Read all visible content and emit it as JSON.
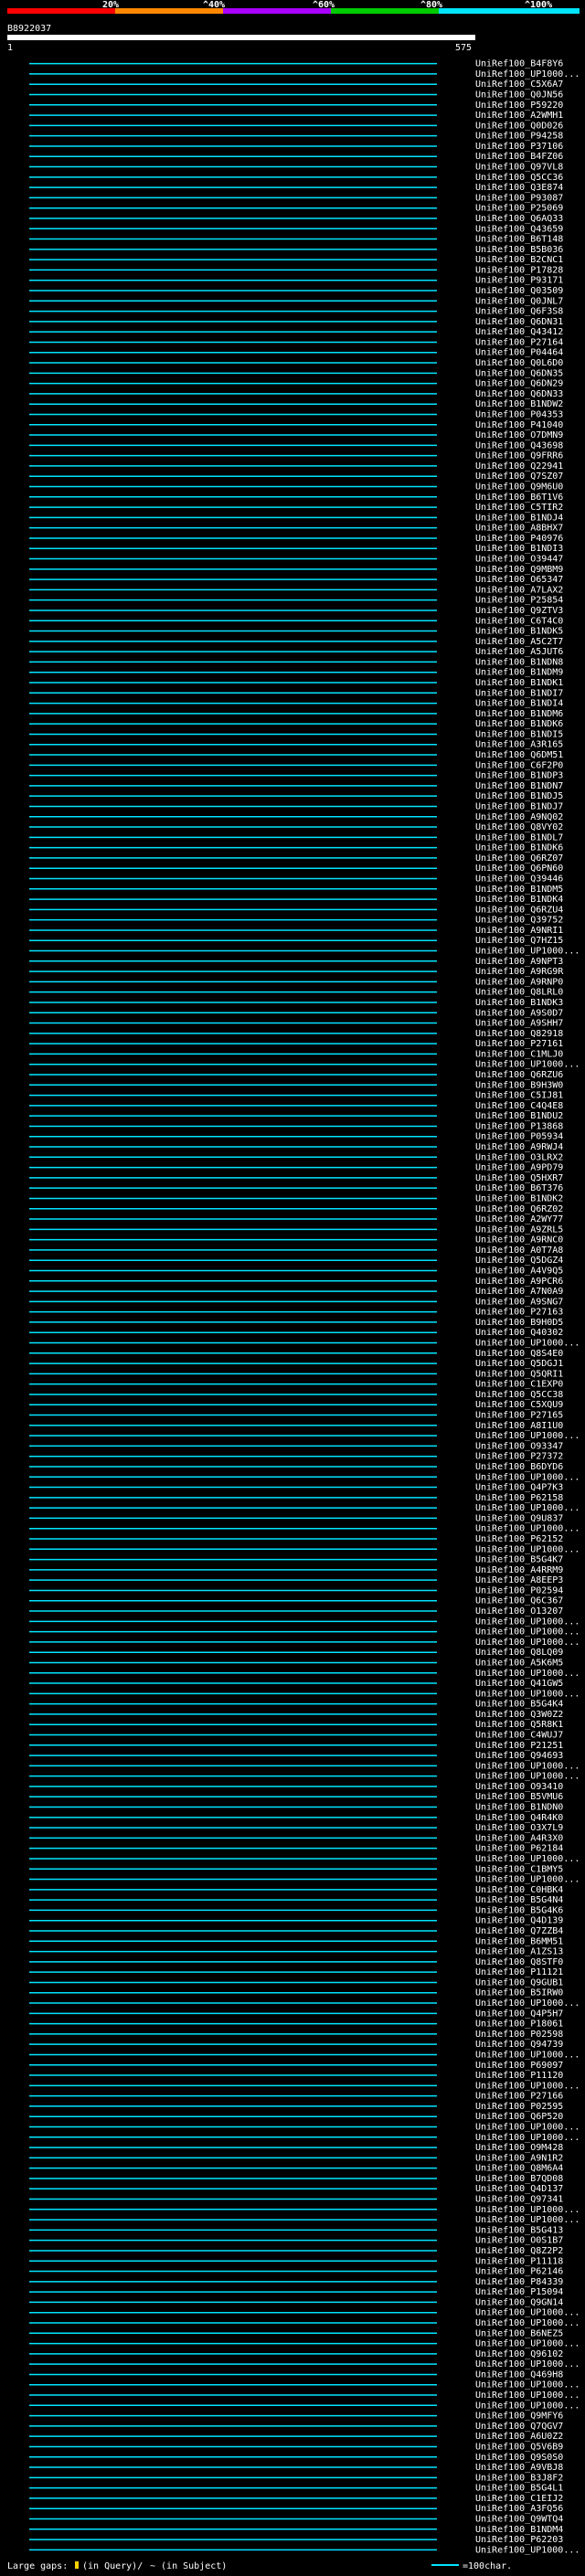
{
  "header": {
    "query_id": "B8922037",
    "start": "1",
    "end": "575"
  },
  "scale": {
    "ticks": [
      "20%",
      "^40%",
      "^60%",
      "^80%",
      "^100%"
    ],
    "colors": [
      "#ff0000",
      "#ff8800",
      "#aa00ff",
      "#00cc00",
      "#00e5ff"
    ]
  },
  "legend": {
    "large_gaps": "Large gaps:",
    "in_query": "(in Query)/",
    "in_subject": "~ (in Subject)",
    "scale_label": "=100char."
  },
  "chart_data": {
    "type": "table",
    "x_range": [
      1,
      575
    ],
    "hits": [
      "UniRef100_B4F8Y6",
      "UniRef100_UP1000...",
      "UniRef100_C5X6A7",
      "UniRef100_Q0JN56",
      "UniRef100_P59220",
      "UniRef100_A2WMH1",
      "UniRef100_Q0D026",
      "UniRef100_P94258",
      "UniRef100_P37106",
      "UniRef100_B4FZ06",
      "UniRef100_Q97VL8",
      "UniRef100_Q5CC36",
      "UniRef100_Q3E874",
      "UniRef100_P93087",
      "UniRef100_P25069",
      "UniRef100_Q6AQ33",
      "UniRef100_Q43659",
      "UniRef100_B6T148",
      "UniRef100_B5B036",
      "UniRef100_B2CNC1",
      "UniRef100_P17828",
      "UniRef100_P93171",
      "UniRef100_Q03509",
      "UniRef100_Q0JNL7",
      "UniRef100_Q6F3S8",
      "UniRef100_Q6DN31",
      "UniRef100_Q43412",
      "UniRef100_P27164",
      "UniRef100_P04464",
      "UniRef100_Q0L6D0",
      "UniRef100_Q6DN35",
      "UniRef100_Q6DN29",
      "UniRef100_Q6DN33",
      "UniRef100_B1NDW2",
      "UniRef100_P04353",
      "UniRef100_P41040",
      "UniRef100_O7DMN9",
      "UniRef100_Q43698",
      "UniRef100_Q9FRR6",
      "UniRef100_Q22941",
      "UniRef100_Q7SZ07",
      "UniRef100_Q9M6U0",
      "UniRef100_B6T1V6",
      "UniRef100_C5TIR2",
      "UniRef100_B1NDJ4",
      "UniRef100_A8BHX7",
      "UniRef100_P40976",
      "UniRef100_B1NDI3",
      "UniRef100_O39447",
      "UniRef100_Q9MBM9",
      "UniRef100_O65347",
      "UniRef100_A7LAX2",
      "UniRef100_P25854",
      "UniRef100_Q9ZTV3",
      "UniRef100_C6T4C0",
      "UniRef100_B1NDK5",
      "UniRef100_A5C2T7",
      "UniRef100_A5JUT6",
      "UniRef100_B1NDN8",
      "UniRef100_B1NDM9",
      "UniRef100_B1NDK1",
      "UniRef100_B1NDI7",
      "UniRef100_B1NDI4",
      "UniRef100_B1NDM6",
      "UniRef100_B1NDK6",
      "UniRef100_B1NDI5",
      "UniRef100_A3R165",
      "UniRef100_Q6DM51",
      "UniRef100_C6F2P0",
      "UniRef100_B1NDP3",
      "UniRef100_B1NDN7",
      "UniRef100_B1NDJ5",
      "UniRef100_B1NDJ7",
      "UniRef100_A9NQ02",
      "UniRef100_Q8VY02",
      "UniRef100_B1NDL7",
      "UniRef100_B1NDK6",
      "UniRef100_Q6RZ07",
      "UniRef100_Q6PN60",
      "UniRef100_Q39446",
      "UniRef100_B1NDM5",
      "UniRef100_B1NDK4",
      "UniRef100_Q6RZU4",
      "UniRef100_Q39752",
      "UniRef100_A9NRI1",
      "UniRef100_Q7HZ15",
      "UniRef100_UP1000...",
      "UniRef100_A9NPT3",
      "UniRef100_A9RG9R",
      "UniRef100_A9RNP0",
      "UniRef100_Q8LRL0",
      "UniRef100_B1NDK3",
      "UniRef100_A9S0D7",
      "UniRef100_A9SHH7",
      "UniRef100_Q82918",
      "UniRef100_P27161",
      "UniRef100_C1MLJ0",
      "UniRef100_UP1000...",
      "UniRef100_Q6RZU6",
      "UniRef100_B9H3W0",
      "UniRef100_C5IJ81",
      "UniRef100_C4Q4E8",
      "UniRef100_B1NDU2",
      "UniRef100_P13868",
      "UniRef100_P05934",
      "UniRef100_A9RWJ4",
      "UniRef100_O3LRX2",
      "UniRef100_A9PD79",
      "UniRef100_Q5HXR7",
      "UniRef100_B6T376",
      "UniRef100_B1NDK2",
      "UniRef100_Q6RZ02",
      "UniRef100_A2WY77",
      "UniRef100_A9ZRL5",
      "UniRef100_A9RNC0",
      "UniRef100_A0T7A8",
      "UniRef100_Q5DGZ4",
      "UniRef100_A4V9Q5",
      "UniRef100_A9PCR6",
      "UniRef100_A7N0A9",
      "UniRef100_A9SNG7",
      "UniRef100_P27163",
      "UniRef100_B9H0D5",
      "UniRef100_Q40302",
      "UniRef100_UP1000...",
      "UniRef100_Q8S4E0",
      "UniRef100_Q5DGJ1",
      "UniRef100_Q5QRI1",
      "UniRef100_C1EXP0",
      "UniRef100_Q5CC38",
      "UniRef100_C5XQU9",
      "UniRef100_P27165",
      "UniRef100_A8I1U0",
      "UniRef100_UP1000...",
      "UniRef100_O93347",
      "UniRef100_P27372",
      "UniRef100_B6DYD6",
      "UniRef100_UP1000...",
      "UniRef100_Q4P7K3",
      "UniRef100_P62158",
      "UniRef100_UP1000...",
      "UniRef100_Q9U837",
      "UniRef100_UP1000...",
      "UniRef100_P62152",
      "UniRef100_UP1000...",
      "UniRef100_B5G4K7",
      "UniRef100_A4RRM9",
      "UniRef100_A8EEP3",
      "UniRef100_P02594",
      "UniRef100_Q6C367",
      "UniRef100_O13207",
      "UniRef100_UP1000...",
      "UniRef100_UP1000...",
      "UniRef100_UP1000...",
      "UniRef100_Q8LQ09",
      "UniRef100_A5K6M5",
      "UniRef100_UP1000...",
      "UniRef100_Q41GW5",
      "UniRef100_UP1000...",
      "UniRef100_B5G4K4",
      "UniRef100_Q3W0Z2",
      "UniRef100_Q5R8K1",
      "UniRef100_C4WUJ7",
      "UniRef100_P21251",
      "UniRef100_Q94693",
      "UniRef100_UP1000...",
      "UniRef100_UP1000...",
      "UniRef100_O93410",
      "UniRef100_B5VMU6",
      "UniRef100_B1NDN0",
      "UniRef100_Q4R4K0",
      "UniRef100_O3X7L9",
      "UniRef100_A4R3X0",
      "UniRef100_P62184",
      "UniRef100_UP1000...",
      "UniRef100_C1BMY5",
      "UniRef100_UP1000...",
      "UniRef100_C0HBK4",
      "UniRef100_B5G4N4",
      "UniRef100_B5G4K6",
      "UniRef100_Q4D139",
      "UniRef100_Q7ZZB4",
      "UniRef100_B6MM51",
      "UniRef100_A1ZS13",
      "UniRef100_Q8STF0",
      "UniRef100_P11121",
      "UniRef100_Q9GUB1",
      "UniRef100_B5IRW0",
      "UniRef100_UP1000...",
      "UniRef100_Q4P5H7",
      "UniRef100_P18061",
      "UniRef100_P02598",
      "UniRef100_Q94739",
      "UniRef100_UP1000...",
      "UniRef100_P69097",
      "UniRef100_P11120",
      "UniRef100_UP1000...",
      "UniRef100_P27166",
      "UniRef100_P02595",
      "UniRef100_Q6P520",
      "UniRef100_UP1000...",
      "UniRef100_UP1000...",
      "UniRef100_O9M428",
      "UniRef100_A9N1R2",
      "UniRef100_Q8M6A4",
      "UniRef100_B7QD08",
      "UniRef100_Q4D137",
      "UniRef100_Q97341",
      "UniRef100_UP1000...",
      "UniRef100_UP1000...",
      "UniRef100_B5G413",
      "UniRef100_O0S1B7",
      "UniRef100_Q8Z2P2",
      "UniRef100_P11118",
      "UniRef100_P62146",
      "UniRef100_P84339",
      "UniRef100_P15094",
      "UniRef100_Q9GN14",
      "UniRef100_UP1000...",
      "UniRef100_UP1000...",
      "UniRef100_B6NEZ5",
      "UniRef100_UP1000...",
      "UniRef100_Q96102",
      "UniRef100_UP1000...",
      "UniRef100_Q469H8",
      "UniRef100_UP1000...",
      "UniRef100_UP1000...",
      "UniRef100_UP1000...",
      "UniRef100_Q9MFY6",
      "UniRef100_Q7QGV7",
      "UniRef100_A6U0Z2",
      "UniRef100_Q5V6B9",
      "UniRef100_Q9S0S0",
      "UniRef100_A9VBJ8",
      "UniRef100_B3J8F2",
      "UniRef100_B5G4L1",
      "UniRef100_C1EIJ2",
      "UniRef100_A3FQ56",
      "UniRef100_Q9WTQ4",
      "UniRef100_B1NDM4",
      "UniRef100_P62203",
      "UniRef100_UP1000..."
    ]
  }
}
